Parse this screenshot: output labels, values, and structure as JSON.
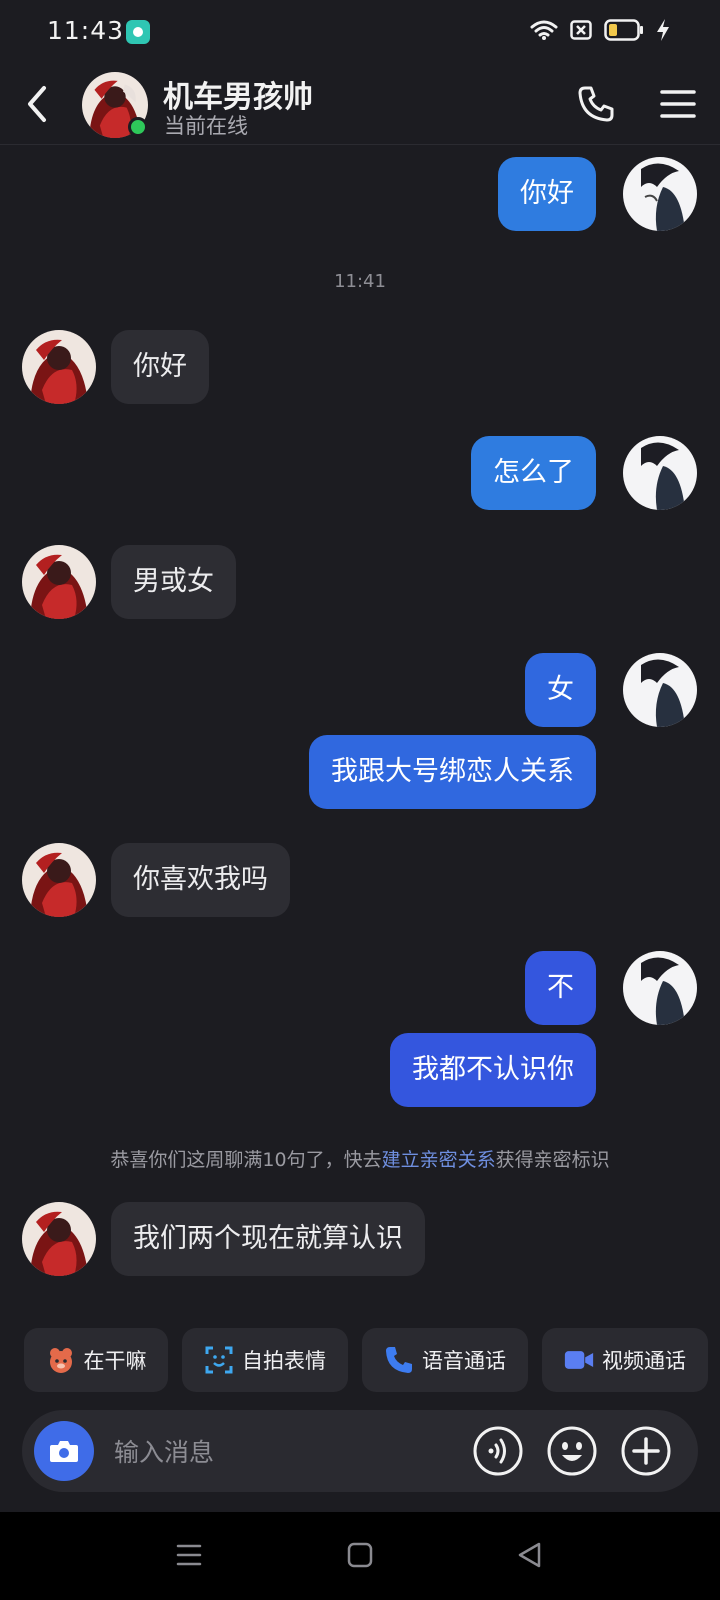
{
  "status_bar": {
    "time": "11:43",
    "icons": [
      "app-notification-icon",
      "wifi-icon",
      "sim-off-icon",
      "battery-icon",
      "charging-icon"
    ]
  },
  "header": {
    "contact_name": "机车男孩帅",
    "contact_status": "当前在线",
    "icons": [
      "back-icon",
      "phone-icon",
      "menu-icon"
    ]
  },
  "messages": [
    {
      "side": "out",
      "text": "你好"
    },
    {
      "type": "time",
      "text": "11:41"
    },
    {
      "side": "in",
      "text": "你好"
    },
    {
      "side": "out",
      "text": "怎么了"
    },
    {
      "side": "in",
      "text": "男或女"
    },
    {
      "side": "out",
      "text": "女"
    },
    {
      "side": "out",
      "text": "我跟大号绑恋人关系"
    },
    {
      "side": "in",
      "text": "你喜欢我吗"
    },
    {
      "side": "out",
      "text": "不"
    },
    {
      "side": "out",
      "text": "我都不认识你"
    },
    {
      "type": "system",
      "before": "恭喜你们这周聊满10句了，快去",
      "link": "建立亲密关系",
      "after": "获得亲密标识"
    },
    {
      "side": "in",
      "text": "我们两个现在就算认识"
    }
  ],
  "quick_actions": [
    {
      "label": "在干嘛",
      "icon": "bear-icon"
    },
    {
      "label": "自拍表情",
      "icon": "face-scan-icon"
    },
    {
      "label": "语音通话",
      "icon": "phone-icon"
    },
    {
      "label": "视频通话",
      "icon": "video-icon"
    }
  ],
  "input": {
    "placeholder": "输入消息",
    "icons": [
      "camera-icon",
      "voice-icon",
      "emoji-icon",
      "plus-icon"
    ]
  },
  "nav": {
    "icons": [
      "recent-apps-icon",
      "home-icon",
      "back-triangle-icon"
    ]
  },
  "colors": {
    "background": "#1c1c21",
    "incoming_bubble": "#2d2d33",
    "outgoing_bubble_top": "#2f7ce0",
    "outgoing_bubble_bottom": "#3456de",
    "online": "#2ec85a",
    "link": "#6f8fe0",
    "camera_button": "#3f6ce8"
  }
}
